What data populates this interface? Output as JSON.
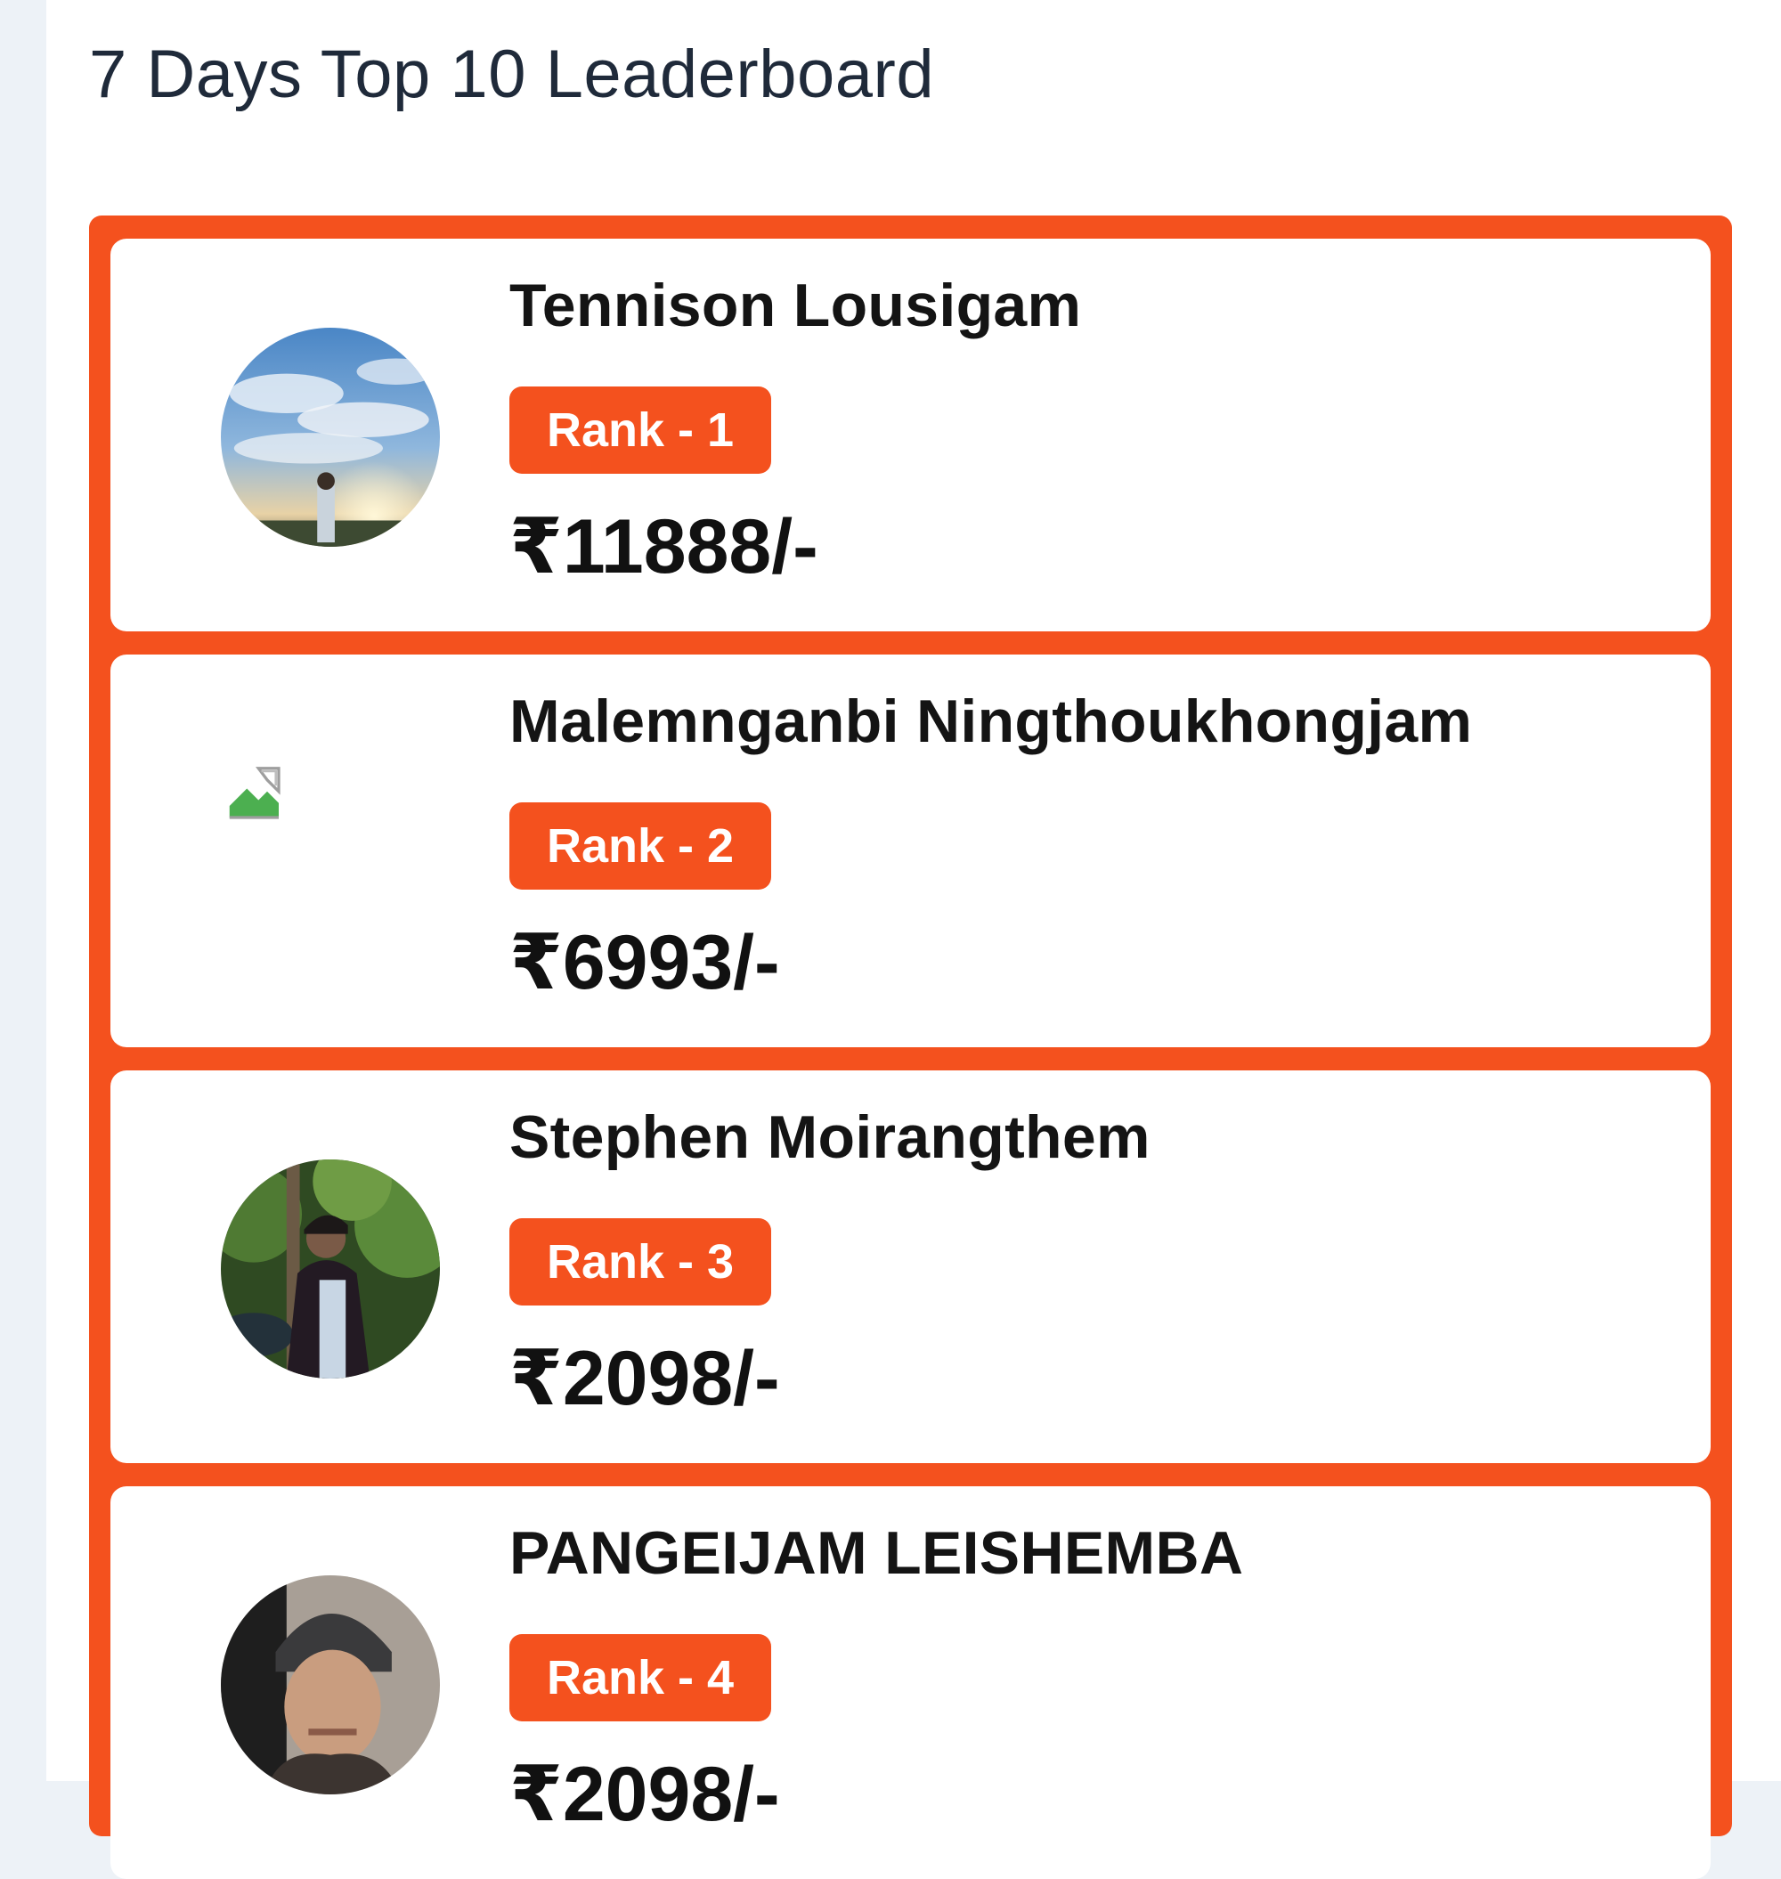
{
  "leaderboard": {
    "title": "7 Days Top 10 Leaderboard",
    "entries": [
      {
        "name": "Tennison Lousigam",
        "rank": "Rank - 1",
        "amount": "₹11888/-"
      },
      {
        "name": "Malemnganbi Ningthoukhongjam",
        "rank": "Rank - 2",
        "amount": "₹6993/-"
      },
      {
        "name": "Stephen Moirangthem",
        "rank": "Rank - 3",
        "amount": "₹2098/-"
      },
      {
        "name": "PANGEIJAM LEISHEMBA",
        "rank": "Rank - 4",
        "amount": "₹2098/-"
      }
    ]
  },
  "colors": {
    "accent": "#f4511e",
    "title_text": "#1f2a3a",
    "page_background": "#edf2f7"
  }
}
